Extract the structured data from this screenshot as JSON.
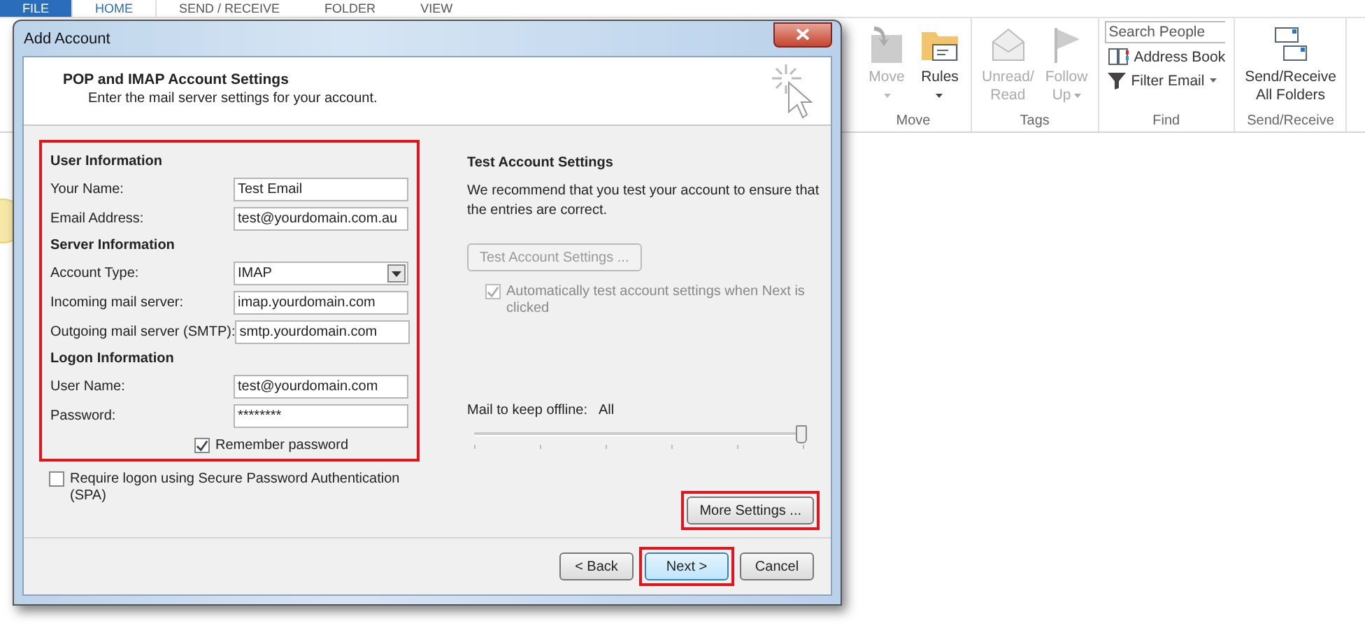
{
  "ribbon_tabs": [
    {
      "label": "FILE",
      "selected": false
    },
    {
      "label": "HOME",
      "selected": true
    },
    {
      "label": "SEND / RECEIVE",
      "selected": false
    },
    {
      "label": "FOLDER",
      "selected": false
    },
    {
      "label": "VIEW",
      "selected": false
    }
  ],
  "ribbon_groups": [
    {
      "label": "Move",
      "items": [
        {
          "kind": "move",
          "lines": [
            "Move"
          ],
          "disabled": true,
          "dropdown": true
        },
        {
          "kind": "rules",
          "lines": [
            "Rules"
          ],
          "disabled": false,
          "dropdown": true
        }
      ]
    },
    {
      "label": "Tags",
      "items": [
        {
          "kind": "unread",
          "lines": [
            "Unread/",
            "Read"
          ],
          "disabled": true,
          "dropdown": false
        },
        {
          "kind": "flag",
          "lines": [
            "Follow",
            "Up"
          ],
          "disabled": true,
          "dropdown": true
        }
      ]
    },
    {
      "label": "Find",
      "items": [
        {
          "kind": "search",
          "placeholder": "Search People"
        },
        {
          "kind": "book",
          "lines": [
            "Address Book"
          ],
          "disabled": false,
          "dropdown": false
        },
        {
          "kind": "filter",
          "lines": [
            "Filter Email"
          ],
          "disabled": false,
          "dropdown": true
        }
      ]
    },
    {
      "label": "Send/Receive",
      "items": [
        {
          "kind": "sendreceive",
          "lines": [
            "Send/Receive",
            "All Folders"
          ],
          "disabled": false,
          "dropdown": false
        }
      ]
    }
  ],
  "dialog": {
    "title": "Add Account",
    "heading": "POP and IMAP Account Settings",
    "subheading": "Enter the mail server settings for your account.",
    "panel": {
      "highlighted": true,
      "sections": [
        {
          "title": "User Information",
          "fields": [
            {
              "kind": "text",
              "label": "Your Name:",
              "value": "Test Email"
            },
            {
              "kind": "text",
              "label": "Email Address:",
              "value": "test@yourdomain.com.au"
            }
          ]
        },
        {
          "title": "Server Information",
          "fields": [
            {
              "kind": "select",
              "label": "Account Type:",
              "value": "IMAP"
            },
            {
              "kind": "text",
              "label": "Incoming mail server:",
              "value": "imap.yourdomain.com"
            },
            {
              "kind": "text",
              "label": "Outgoing mail server (SMTP):",
              "value": "smtp.yourdomain.com"
            }
          ]
        },
        {
          "title": "Logon Information",
          "fields": [
            {
              "kind": "text",
              "label": "User Name:",
              "value": "test@yourdomain.com"
            },
            {
              "kind": "text",
              "label": "Password:",
              "value": "********"
            }
          ]
        }
      ],
      "remember": {
        "label": "Remember password",
        "checked": true
      }
    },
    "spa": {
      "label": "Require logon using Secure Password Authentication (SPA)",
      "checked": false
    },
    "test": {
      "title": "Test Account Settings",
      "text": "We recommend that you test your account to ensure that the entries are correct.",
      "button": {
        "label": "Test Account Settings ...",
        "disabled": true
      },
      "auto": {
        "label": "Automatically test account settings when Next is clicked",
        "checked": true,
        "disabled": true
      }
    },
    "offline": {
      "label": "Mail to keep offline:",
      "reading": "All",
      "level": 1
    },
    "more_settings": {
      "label": "More Settings ...",
      "highlighted": true
    },
    "buttons": [
      {
        "label": "< Back",
        "default": false,
        "highlighted": false
      },
      {
        "label": "Next >",
        "default": true,
        "highlighted": true
      },
      {
        "label": "Cancel",
        "default": false,
        "highlighted": false
      }
    ]
  }
}
